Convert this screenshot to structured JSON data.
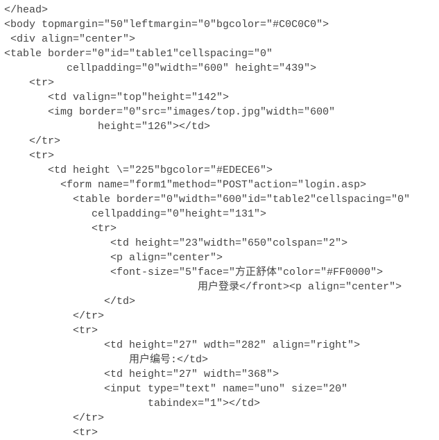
{
  "code_lines": [
    "</head>",
    "<body topmargin=\"50\"leftmargin=\"0\"bgcolor=\"#C0C0C0\">",
    " <div align=\"center\">",
    "<table border=\"0\"id=\"table1\"cellspacing=\"0\"",
    "          cellpadding=\"0\"width=\"600\" height=\"439\">",
    "    <tr>",
    "       <td valign=\"top\"height=\"142\">",
    "       <img border=\"0\"src=\"images/top.jpg\"width=\"600\"",
    "               height=\"126\"></td>",
    "    </tr>",
    "    <tr>",
    "       <td height \\=\"225\"bgcolor=\"#EDECE6\">",
    "         <form name=\"form1\"method=\"POST\"action=\"login.asp>",
    "           <table border=\"0\"width=\"600\"id=\"table2\"cellspacing=\"0\"",
    "              cellpadding=\"0\"height=\"131\">",
    "              <tr>",
    "                 <td height=\"23\"width=\"650\"colspan=\"2\">",
    "                 <p align=\"center\">",
    "                 <font-size=\"5\"face=\"方正舒体\"color=\"#FF0000\">",
    "                               用户登录</front><p align=\"center\">",
    "                </td>",
    "           </tr>",
    "           <tr>",
    "                <td height=\"27\" wdth=\"282\" align=\"right\">",
    "                    用户编号:</td>",
    "",
    "                <td height=\"27\" width=\"368\">",
    "                <input type=\"text\" name=\"uno\" size=\"20\"",
    "                       tabindex=\"1\"></td>",
    "           </tr>",
    "           <tr>"
  ]
}
